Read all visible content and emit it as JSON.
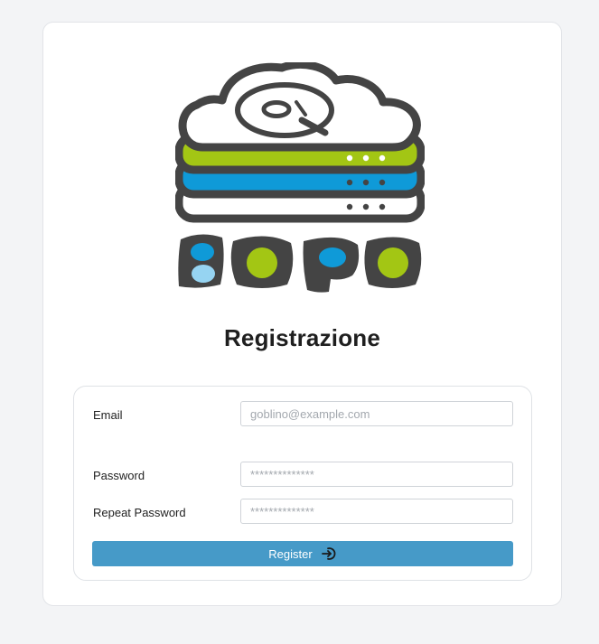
{
  "logo": {
    "text": "BOPO",
    "name": "bopo-logo"
  },
  "page": {
    "title": "Registrazione"
  },
  "form": {
    "email_label": "Email",
    "email_placeholder": "goblino@example.com",
    "password_label": "Password",
    "password_placeholder": "**************",
    "repeat_password_label": "Repeat Password",
    "repeat_password_placeholder": "**************",
    "register_label": "Register"
  },
  "icons": {
    "register_icon": "sign-in-icon"
  },
  "colors": {
    "dark_gray": "#444444",
    "green": "#a3c614",
    "blue": "#0f9ad8",
    "light_blue": "#96d4f2",
    "button": "#469ac8",
    "background": "#f3f4f6"
  }
}
